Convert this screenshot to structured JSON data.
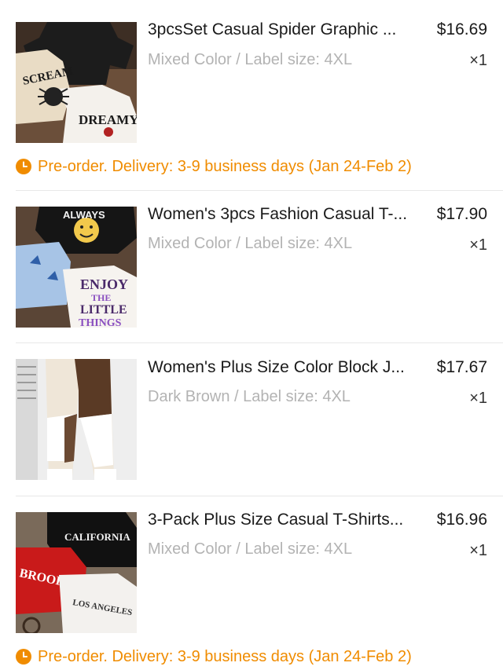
{
  "items": [
    {
      "title": "3pcsSet Casual Spider Graphic ...",
      "price": "$16.69",
      "variant": "Mixed Color / Label size: 4XL",
      "quantity": "×1",
      "preorder": "Pre-order. Delivery: 3-9 business days (Jan 24-Feb 2)",
      "image_text": [
        "SCREAM",
        "DREAMY"
      ]
    },
    {
      "title": "Women's 3pcs Fashion Casual T-...",
      "price": "$17.90",
      "variant": "Mixed Color / Label size: 4XL",
      "quantity": "×1",
      "image_text": [
        "ALWAYS",
        "ENJOY",
        "THE",
        "LITTLE",
        "THINGS"
      ]
    },
    {
      "title": "Women's Plus Size Color Block J...",
      "price": "$17.67",
      "variant": "Dark Brown / Label size: 4XL",
      "quantity": "×1"
    },
    {
      "title": "3-Pack Plus Size Casual T-Shirts...",
      "price": "$16.96",
      "variant": "Mixed Color / Label size: 4XL",
      "quantity": "×1",
      "preorder": "Pre-order. Delivery: 3-9 business days (Jan 24-Feb 2)",
      "image_text": [
        "CALIFORNIA",
        "BROOKLYN",
        "LOS ANGELES"
      ]
    }
  ],
  "colors": {
    "preorder": "#f08c00",
    "title": "#1a1a1a",
    "variant": "#b3b3b3",
    "divider": "#e8e8e8"
  }
}
